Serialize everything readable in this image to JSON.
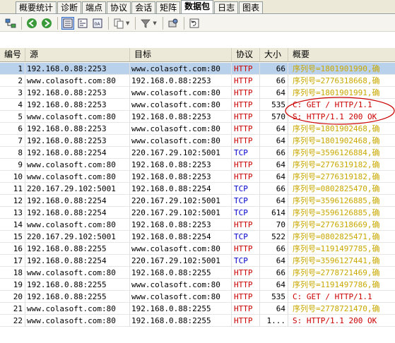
{
  "tabs": [
    "概要统计",
    "诊断",
    "端点",
    "协议",
    "会话",
    "矩阵",
    "数据包",
    "日志",
    "图表"
  ],
  "active_tab": "数据包",
  "columns": {
    "no": "编号",
    "src": "源",
    "dst": "目标",
    "proto": "协议",
    "size": "大小",
    "summary": "概要"
  },
  "colors": {
    "http": "#cc0000",
    "tcp": "#0000cc",
    "http_summary": "#c9a800",
    "tcp_summary": "#c9a800",
    "highlight_summary": "#cc0000",
    "selection": "#b9d1ea",
    "ellipse": "#cc0000"
  },
  "toolbar_icons": [
    "network-icon",
    "back-icon",
    "forward-icon",
    "list-view-icon",
    "detail-view-icon",
    "hex-view-icon",
    "copy-icon",
    "filter-icon",
    "export-icon",
    "refresh-icon"
  ],
  "rows": [
    {
      "no": "1",
      "src": "192.168.0.88:2253",
      "dst": "www.colasoft.com:80",
      "proto": "HTTP",
      "size": "66",
      "summary": "序列号=1801901990,确",
      "hl": false
    },
    {
      "no": "2",
      "src": "www.colasoft.com:80",
      "dst": "192.168.0.88:2253",
      "proto": "HTTP",
      "size": "66",
      "summary": "序列号=2776318668,确",
      "hl": false
    },
    {
      "no": "3",
      "src": "192.168.0.88:2253",
      "dst": "www.colasoft.com:80",
      "proto": "HTTP",
      "size": "64",
      "summary": "序列号=1801901991,确",
      "hl": false
    },
    {
      "no": "4",
      "src": "192.168.0.88:2253",
      "dst": "www.colasoft.com:80",
      "proto": "HTTP",
      "size": "535",
      "summary": "C: GET / HTTP/1.1",
      "hl": true
    },
    {
      "no": "5",
      "src": "www.colasoft.com:80",
      "dst": "192.168.0.88:2253",
      "proto": "HTTP",
      "size": "570",
      "summary": "S: HTTP/1.1 200 OK",
      "hl": true
    },
    {
      "no": "6",
      "src": "192.168.0.88:2253",
      "dst": "www.colasoft.com:80",
      "proto": "HTTP",
      "size": "64",
      "summary": "序列号=1801902468,确",
      "hl": false
    },
    {
      "no": "7",
      "src": "192.168.0.88:2253",
      "dst": "www.colasoft.com:80",
      "proto": "HTTP",
      "size": "64",
      "summary": "序列号=1801902468,确",
      "hl": false
    },
    {
      "no": "8",
      "src": "192.168.0.88:2254",
      "dst": "220.167.29.102:5001",
      "proto": "TCP",
      "size": "66",
      "summary": "序列号=3596126884,确",
      "hl": false
    },
    {
      "no": "9",
      "src": "www.colasoft.com:80",
      "dst": "192.168.0.88:2253",
      "proto": "HTTP",
      "size": "64",
      "summary": "序列号=2776319182,确",
      "hl": false
    },
    {
      "no": "10",
      "src": "www.colasoft.com:80",
      "dst": "192.168.0.88:2253",
      "proto": "HTTP",
      "size": "64",
      "summary": "序列号=2776319182,确",
      "hl": false
    },
    {
      "no": "11",
      "src": "220.167.29.102:5001",
      "dst": "192.168.0.88:2254",
      "proto": "TCP",
      "size": "66",
      "summary": "序列号=0802825470,确",
      "hl": false
    },
    {
      "no": "12",
      "src": "192.168.0.88:2254",
      "dst": "220.167.29.102:5001",
      "proto": "TCP",
      "size": "64",
      "summary": "序列号=3596126885,确",
      "hl": false
    },
    {
      "no": "13",
      "src": "192.168.0.88:2254",
      "dst": "220.167.29.102:5001",
      "proto": "TCP",
      "size": "614",
      "summary": "序列号=3596126885,确",
      "hl": false
    },
    {
      "no": "14",
      "src": "www.colasoft.com:80",
      "dst": "192.168.0.88:2253",
      "proto": "HTTP",
      "size": "70",
      "summary": "序列号=2776318669,确",
      "hl": false
    },
    {
      "no": "15",
      "src": "220.167.29.102:5001",
      "dst": "192.168.0.88:2254",
      "proto": "TCP",
      "size": "522",
      "summary": "序列号=0802825471,确",
      "hl": false
    },
    {
      "no": "16",
      "src": "192.168.0.88:2255",
      "dst": "www.colasoft.com:80",
      "proto": "HTTP",
      "size": "66",
      "summary": "序列号=1191497785,确",
      "hl": false
    },
    {
      "no": "17",
      "src": "192.168.0.88:2254",
      "dst": "220.167.29.102:5001",
      "proto": "TCP",
      "size": "64",
      "summary": "序列号=3596127441,确",
      "hl": false
    },
    {
      "no": "18",
      "src": "www.colasoft.com:80",
      "dst": "192.168.0.88:2255",
      "proto": "HTTP",
      "size": "66",
      "summary": "序列号=2778721469,确",
      "hl": false
    },
    {
      "no": "19",
      "src": "192.168.0.88:2255",
      "dst": "www.colasoft.com:80",
      "proto": "HTTP",
      "size": "64",
      "summary": "序列号=1191497786,确",
      "hl": false
    },
    {
      "no": "20",
      "src": "192.168.0.88:2255",
      "dst": "www.colasoft.com:80",
      "proto": "HTTP",
      "size": "535",
      "summary": "C: GET / HTTP/1.1",
      "hl": true
    },
    {
      "no": "21",
      "src": "www.colasoft.com:80",
      "dst": "192.168.0.88:2255",
      "proto": "HTTP",
      "size": "64",
      "summary": "序列号=2778721470,确",
      "hl": false
    },
    {
      "no": "22",
      "src": "www.colasoft.com:80",
      "dst": "192.168.0.88:2255",
      "proto": "HTTP",
      "size": "1...",
      "summary": "S: HTTP/1.1 200 OK",
      "hl": true
    }
  ]
}
